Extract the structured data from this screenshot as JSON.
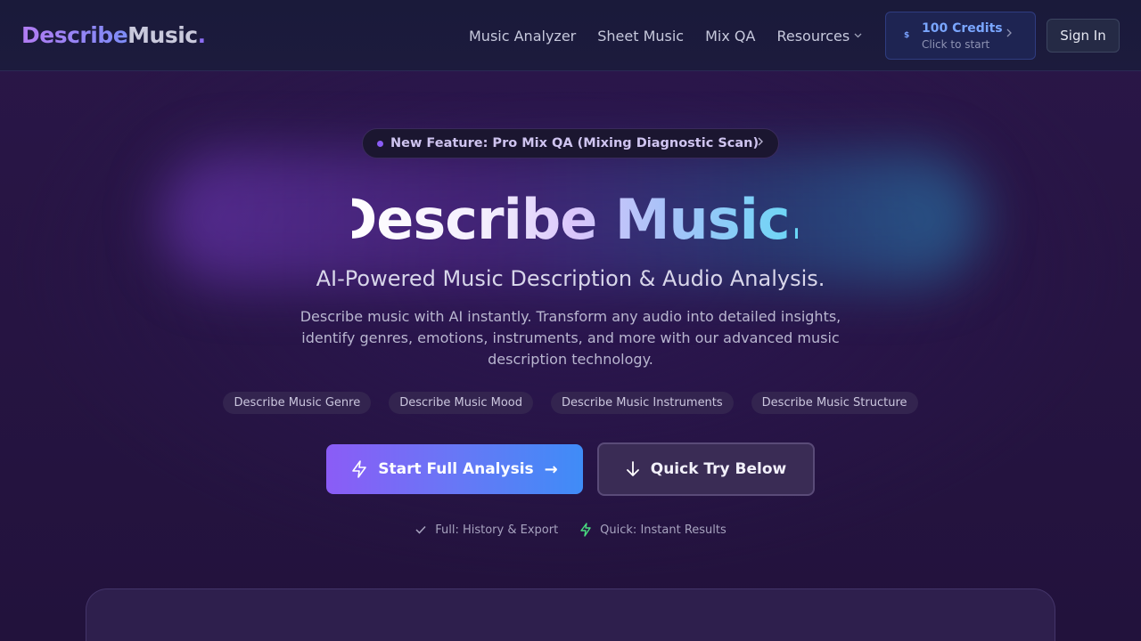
{
  "logo": {
    "part1": "Describe",
    "part2": "Music",
    "part3": "."
  },
  "nav": {
    "links": [
      "Music Analyzer",
      "Sheet Music",
      "Mix QA",
      "Resources"
    ],
    "resources_chevron": "chevron-down-icon"
  },
  "credits": {
    "symbol": "$",
    "amount": "100 Credits",
    "subtitle": "Click to start"
  },
  "signin_label": "Sign In",
  "announcement": {
    "text": "New Feature: Pro Mix QA (Mixing Diagnostic Scan)"
  },
  "hero": {
    "title": "Describe Music.",
    "subtitle": "AI-Powered Music Description & Audio Analysis.",
    "description": "Describe music with AI instantly. Transform any audio into detailed insights, identify genres, emotions, instruments, and more with our advanced music description technology."
  },
  "tags": [
    "Describe Music Genre",
    "Describe Music Mood",
    "Describe Music Instruments",
    "Describe Music Structure"
  ],
  "buttons": {
    "primary_label": "Start Full Analysis",
    "primary_arrow": "→",
    "secondary_label": "Quick Try Below"
  },
  "features": [
    "Full: History & Export",
    "Quick: Instant Results"
  ],
  "colors": {
    "background": "#25143f",
    "navbar": "#1a1a3a",
    "accent_purple": "#8b5cf6",
    "accent_blue": "#3f8cf7",
    "credits_text": "#7aa6ff"
  }
}
